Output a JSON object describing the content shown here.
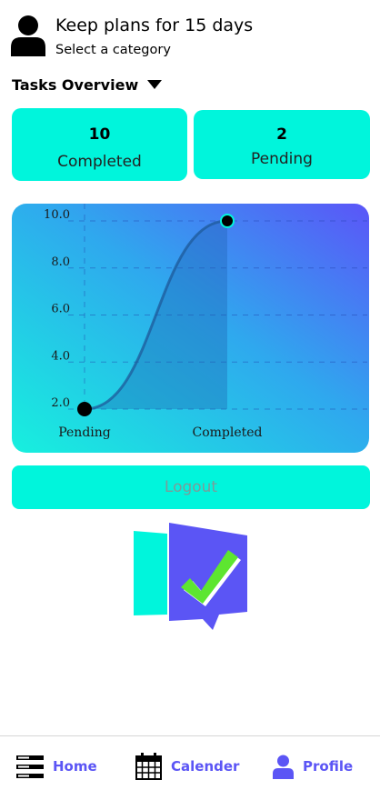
{
  "colors": {
    "accent": "#00f5dc",
    "purple": "#5b55f5",
    "check_green": "#5de630",
    "chart_gradient_start": "#17f0de",
    "chart_gradient_end": "#5b55f8"
  },
  "header": {
    "title": "Keep plans for 15 days",
    "subtitle": "Select a category",
    "avatar_icon": "user-icon"
  },
  "overview": {
    "label": "Tasks Overview",
    "caret_icon": "caret-down-icon"
  },
  "stats": [
    {
      "count": "10",
      "label": "Completed"
    },
    {
      "count": "2",
      "label": "Pending"
    }
  ],
  "chart_data": {
    "type": "area",
    "categories": [
      "Pending",
      "Completed"
    ],
    "values": [
      2,
      10
    ],
    "yticks": [
      "2.0",
      "4.0",
      "6.0",
      "8.0",
      "10.0"
    ],
    "ylim": [
      2,
      10
    ],
    "title": "",
    "xlabel": "",
    "ylabel": "",
    "grid": true,
    "legend": "none"
  },
  "logout": {
    "label": "Logout"
  },
  "logo_icon": "check-logo-icon",
  "nav": {
    "items": [
      {
        "label": "Home",
        "icon": "menu-list-icon"
      },
      {
        "label": "Calender",
        "icon": "calendar-icon"
      },
      {
        "label": "Profile",
        "icon": "user-icon"
      }
    ]
  }
}
